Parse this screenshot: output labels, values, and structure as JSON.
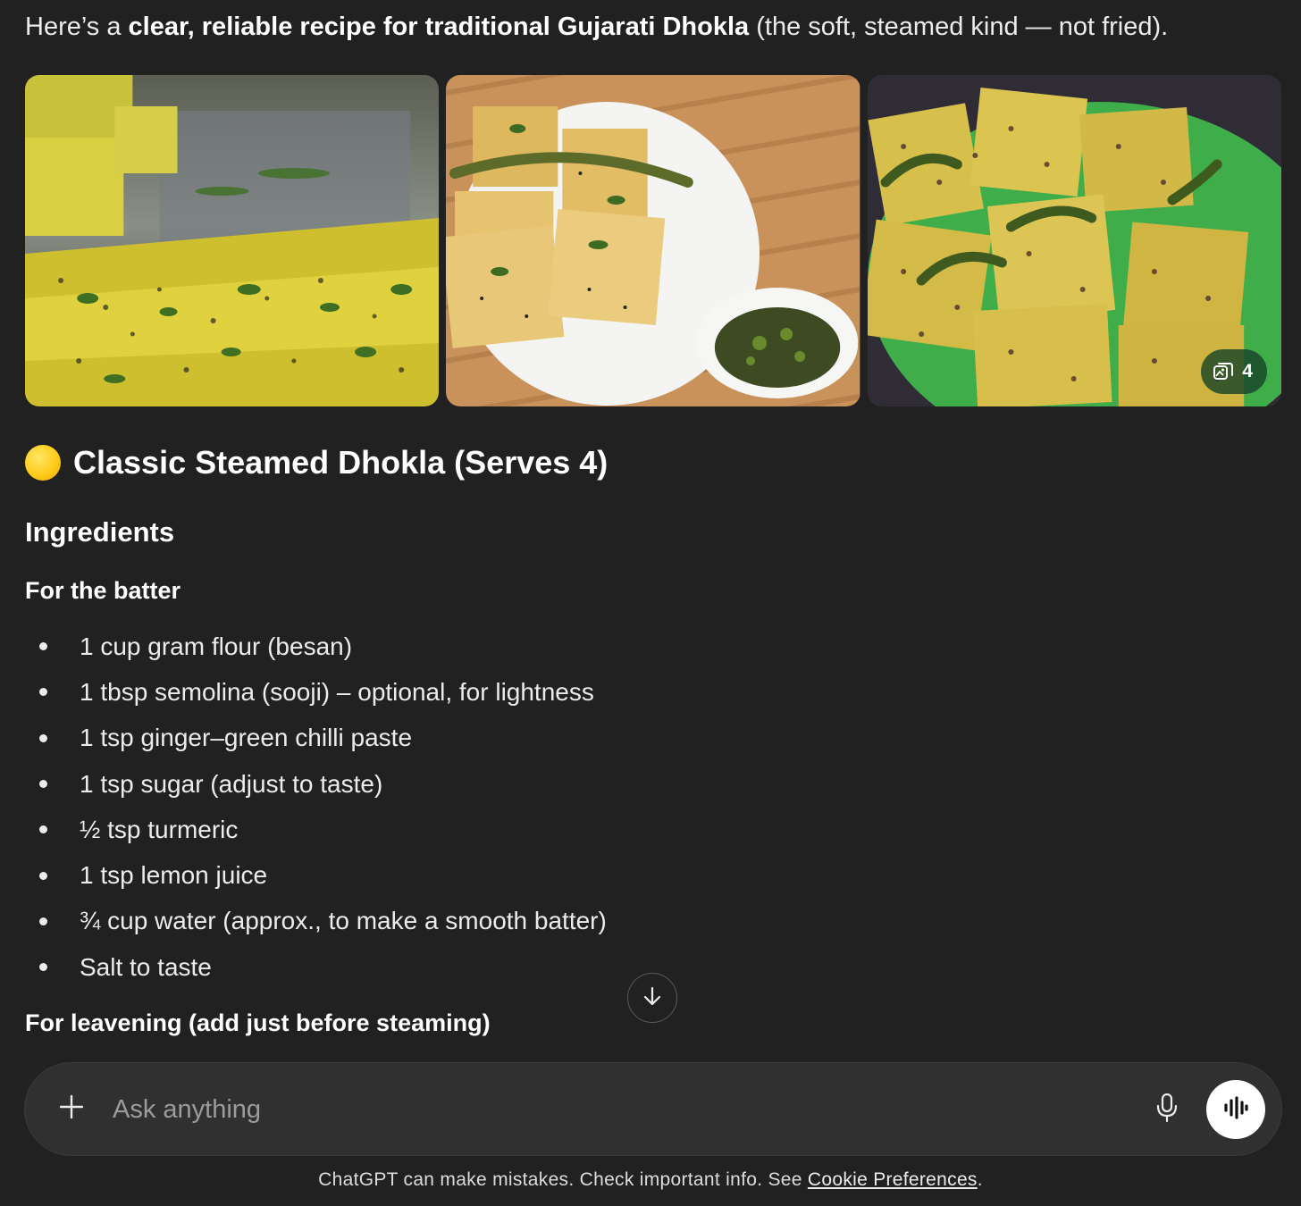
{
  "intro": {
    "prefix": "Here’s a ",
    "bold": "clear, reliable recipe for traditional Gujarati Dhokla",
    "suffix": " (the soft, steamed kind — not fried)."
  },
  "gallery": {
    "images": [
      {
        "name": "dhokla-photo-1"
      },
      {
        "name": "dhokla-photo-2"
      },
      {
        "name": "dhokla-photo-3"
      }
    ],
    "count_badge": "4",
    "icon": "image-stack-icon"
  },
  "recipe": {
    "emoji": "yellow-circle-emoji",
    "title": "Classic Steamed Dhokla (Serves 4)",
    "ingredients_heading": "Ingredients",
    "batter_heading": "For the batter",
    "batter_items": [
      "1 cup gram flour (besan)",
      "1 tbsp semolina (sooji) – optional, for lightness",
      "1 tsp ginger–green chilli paste",
      "1 tsp sugar (adjust to taste)",
      "½ tsp turmeric",
      "1 tsp lemon juice",
      "¾ cup water (approx., to make a smooth batter)",
      "Salt to taste"
    ],
    "leavening_heading": "For leavening (add just before steaming)"
  },
  "composer": {
    "placeholder": "Ask anything",
    "icons": [
      "plus-icon",
      "microphone-icon",
      "voice-waveform-icon"
    ]
  },
  "footer": {
    "disclaimer_prefix": "ChatGPT can make mistakes. Check important info. See ",
    "link": "Cookie Preferences",
    "suffix": "."
  },
  "colors": {
    "background": "#212121",
    "composer": "#303030",
    "text": "#ececec"
  }
}
